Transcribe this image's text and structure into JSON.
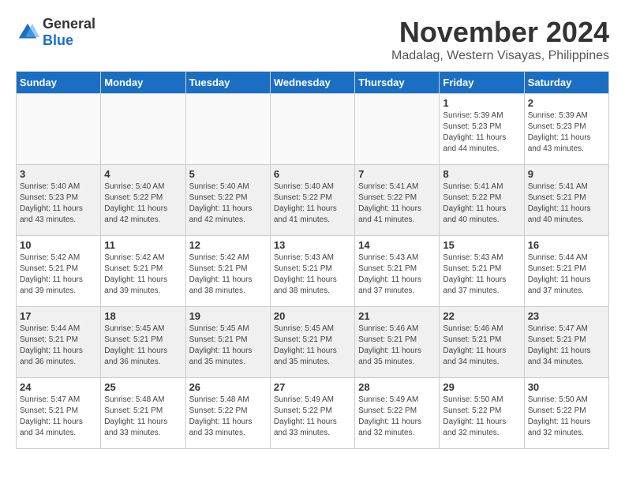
{
  "header": {
    "logo_general": "General",
    "logo_blue": "Blue",
    "month_year": "November 2024",
    "location": "Madalag, Western Visayas, Philippines"
  },
  "days_of_week": [
    "Sunday",
    "Monday",
    "Tuesday",
    "Wednesday",
    "Thursday",
    "Friday",
    "Saturday"
  ],
  "weeks": [
    [
      {
        "day": "",
        "info": ""
      },
      {
        "day": "",
        "info": ""
      },
      {
        "day": "",
        "info": ""
      },
      {
        "day": "",
        "info": ""
      },
      {
        "day": "",
        "info": ""
      },
      {
        "day": "1",
        "info": "Sunrise: 5:39 AM\nSunset: 5:23 PM\nDaylight: 11 hours and 44 minutes."
      },
      {
        "day": "2",
        "info": "Sunrise: 5:39 AM\nSunset: 5:23 PM\nDaylight: 11 hours and 43 minutes."
      }
    ],
    [
      {
        "day": "3",
        "info": "Sunrise: 5:40 AM\nSunset: 5:23 PM\nDaylight: 11 hours and 43 minutes."
      },
      {
        "day": "4",
        "info": "Sunrise: 5:40 AM\nSunset: 5:22 PM\nDaylight: 11 hours and 42 minutes."
      },
      {
        "day": "5",
        "info": "Sunrise: 5:40 AM\nSunset: 5:22 PM\nDaylight: 11 hours and 42 minutes."
      },
      {
        "day": "6",
        "info": "Sunrise: 5:40 AM\nSunset: 5:22 PM\nDaylight: 11 hours and 41 minutes."
      },
      {
        "day": "7",
        "info": "Sunrise: 5:41 AM\nSunset: 5:22 PM\nDaylight: 11 hours and 41 minutes."
      },
      {
        "day": "8",
        "info": "Sunrise: 5:41 AM\nSunset: 5:22 PM\nDaylight: 11 hours and 40 minutes."
      },
      {
        "day": "9",
        "info": "Sunrise: 5:41 AM\nSunset: 5:21 PM\nDaylight: 11 hours and 40 minutes."
      }
    ],
    [
      {
        "day": "10",
        "info": "Sunrise: 5:42 AM\nSunset: 5:21 PM\nDaylight: 11 hours and 39 minutes."
      },
      {
        "day": "11",
        "info": "Sunrise: 5:42 AM\nSunset: 5:21 PM\nDaylight: 11 hours and 39 minutes."
      },
      {
        "day": "12",
        "info": "Sunrise: 5:42 AM\nSunset: 5:21 PM\nDaylight: 11 hours and 38 minutes."
      },
      {
        "day": "13",
        "info": "Sunrise: 5:43 AM\nSunset: 5:21 PM\nDaylight: 11 hours and 38 minutes."
      },
      {
        "day": "14",
        "info": "Sunrise: 5:43 AM\nSunset: 5:21 PM\nDaylight: 11 hours and 37 minutes."
      },
      {
        "day": "15",
        "info": "Sunrise: 5:43 AM\nSunset: 5:21 PM\nDaylight: 11 hours and 37 minutes."
      },
      {
        "day": "16",
        "info": "Sunrise: 5:44 AM\nSunset: 5:21 PM\nDaylight: 11 hours and 37 minutes."
      }
    ],
    [
      {
        "day": "17",
        "info": "Sunrise: 5:44 AM\nSunset: 5:21 PM\nDaylight: 11 hours and 36 minutes."
      },
      {
        "day": "18",
        "info": "Sunrise: 5:45 AM\nSunset: 5:21 PM\nDaylight: 11 hours and 36 minutes."
      },
      {
        "day": "19",
        "info": "Sunrise: 5:45 AM\nSunset: 5:21 PM\nDaylight: 11 hours and 35 minutes."
      },
      {
        "day": "20",
        "info": "Sunrise: 5:45 AM\nSunset: 5:21 PM\nDaylight: 11 hours and 35 minutes."
      },
      {
        "day": "21",
        "info": "Sunrise: 5:46 AM\nSunset: 5:21 PM\nDaylight: 11 hours and 35 minutes."
      },
      {
        "day": "22",
        "info": "Sunrise: 5:46 AM\nSunset: 5:21 PM\nDaylight: 11 hours and 34 minutes."
      },
      {
        "day": "23",
        "info": "Sunrise: 5:47 AM\nSunset: 5:21 PM\nDaylight: 11 hours and 34 minutes."
      }
    ],
    [
      {
        "day": "24",
        "info": "Sunrise: 5:47 AM\nSunset: 5:21 PM\nDaylight: 11 hours and 34 minutes."
      },
      {
        "day": "25",
        "info": "Sunrise: 5:48 AM\nSunset: 5:21 PM\nDaylight: 11 hours and 33 minutes."
      },
      {
        "day": "26",
        "info": "Sunrise: 5:48 AM\nSunset: 5:22 PM\nDaylight: 11 hours and 33 minutes."
      },
      {
        "day": "27",
        "info": "Sunrise: 5:49 AM\nSunset: 5:22 PM\nDaylight: 11 hours and 33 minutes."
      },
      {
        "day": "28",
        "info": "Sunrise: 5:49 AM\nSunset: 5:22 PM\nDaylight: 11 hours and 32 minutes."
      },
      {
        "day": "29",
        "info": "Sunrise: 5:50 AM\nSunset: 5:22 PM\nDaylight: 11 hours and 32 minutes."
      },
      {
        "day": "30",
        "info": "Sunrise: 5:50 AM\nSunset: 5:22 PM\nDaylight: 11 hours and 32 minutes."
      }
    ]
  ]
}
